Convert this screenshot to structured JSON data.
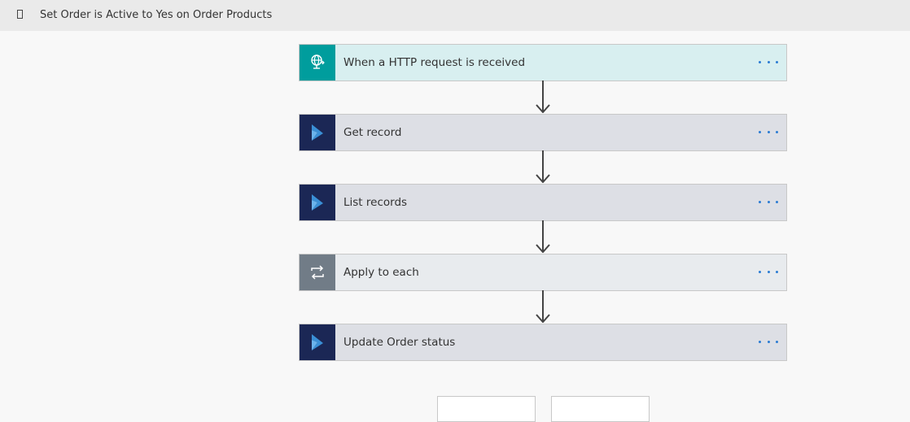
{
  "header": {
    "title": "Set Order is Active to Yes on Order Products",
    "icon": "document-icon"
  },
  "colors": {
    "http_accent": "#009d9d",
    "http_bg": "#d8eff0",
    "dynamics_accent": "#1b2755",
    "dynamics_bg": "#dddfe5",
    "loop_accent": "#717c87",
    "loop_bg": "#e8ebee",
    "more_dots": "#2b7cd3"
  },
  "steps": [
    {
      "label": "When a HTTP request is received",
      "icon": "http-request-icon"
    },
    {
      "label": "Get record",
      "icon": "dynamics-icon"
    },
    {
      "label": "List records",
      "icon": "dynamics-icon"
    },
    {
      "label": "Apply to each",
      "icon": "loop-icon"
    },
    {
      "label": "Update Order status",
      "icon": "dynamics-icon"
    }
  ]
}
